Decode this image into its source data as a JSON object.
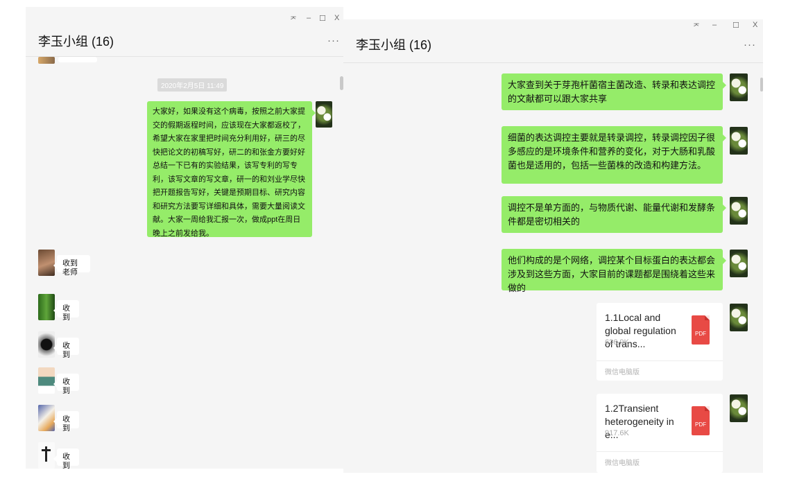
{
  "left": {
    "title": "李玉小组 (16)",
    "controls": {
      "pin": "ᅎ",
      "min": "–",
      "max": "☐",
      "close": "X"
    },
    "more": "···",
    "timestamp": "2020年2月5日 11:49",
    "long_message": "大家好，如果没有这个病毒，按照之前大家提交的假期返程时间，应该现在大家都返校了，希望大家在家里把时间充分利用好，研三的尽快把论文的初稿写好，研二的和张金方要好好总结一下已有的实验结果，该写专利的写专利，该写文章的写文章，研一的和刘业学尽快把开题报告写好，关键是预期目标、研究内容和研究方法要写详细和具体，需要大量阅读文献。大家一周给我汇报一次，做成ppt在周日晚上之前发给我。",
    "replies": [
      {
        "text": "收到老师",
        "avatar": "portrait-avatar"
      },
      {
        "text": "收到",
        "avatar": "leaf-avatar"
      },
      {
        "text": "收到",
        "avatar": "circle-avatar"
      },
      {
        "text": "收到",
        "avatar": "cartoon-avatar"
      },
      {
        "text": "收到",
        "avatar": "cat-avatar"
      },
      {
        "text": "收到",
        "avatar": "figure-avatar"
      }
    ]
  },
  "right": {
    "title": "李玉小组 (16)",
    "controls": {
      "pin": "ᅎ",
      "min": "–",
      "max": "☐",
      "close": "X"
    },
    "more": "···",
    "messages": [
      "大家查到关于芽孢杆菌宿主菌改造、转录和表达调控的文献都可以跟大家共享",
      "细菌的表达调控主要就是转录调控，转录调控因子很多感应的是环境条件和营养的变化，对于大肠和乳酸菌也是适用的，包括一些菌株的改造和构建方法。",
      "调控不是单方面的，与物质代谢、能量代谢和发酵条件都是密切相关的",
      "他们构成的是个网络，调控某个目标蛋白的表达都会涉及到这些方面，大家目前的课题都是围绕着这些来做的"
    ],
    "files": [
      {
        "name": "1.1Local and global regulation of trans...",
        "size": "626.9K",
        "icon": "PDF",
        "source": "微信电脑版"
      },
      {
        "name": "1.2Transient heterogeneity in e...",
        "size": "917.6K",
        "icon": "PDF",
        "source": "微信电脑版"
      }
    ]
  },
  "colors": {
    "bubble_green": "#95ec69",
    "background": "#f5f5f5",
    "pdf_red": "#e84a45"
  }
}
